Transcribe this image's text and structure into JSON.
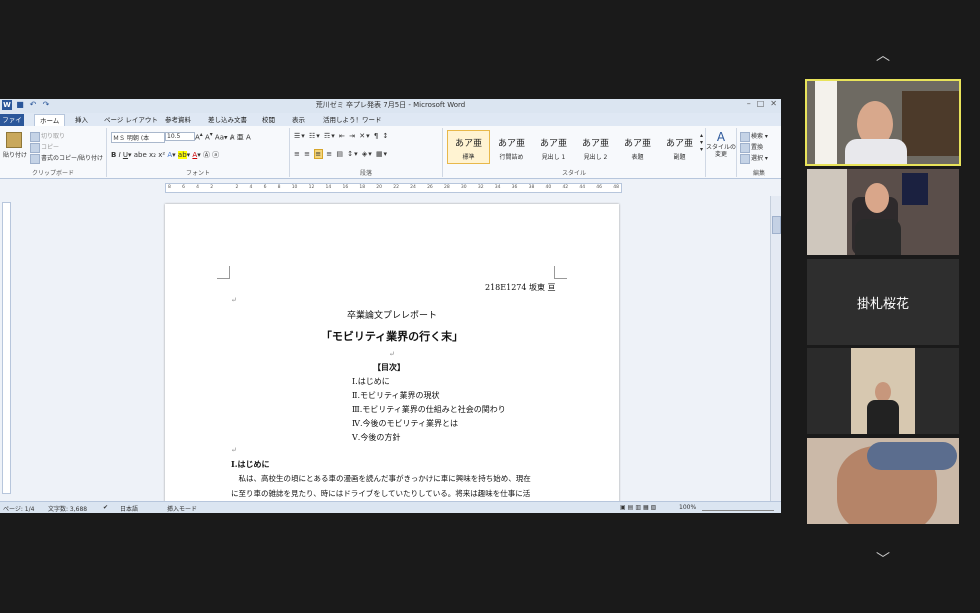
{
  "window": {
    "title": "荒川ゼミ 卒プレ発表 7月5日 - Microsoft Word",
    "qat_logo": "W"
  },
  "tabs": [
    "ファイル",
    "ホーム",
    "挿入",
    "ページ レイアウト",
    "参考資料",
    "差し込み文書",
    "校閲",
    "表示",
    "活用しよう！ワード"
  ],
  "ribbon": {
    "clipboard": {
      "paste": "貼り付け",
      "cut": "切り取り",
      "copy": "コピー",
      "format_painter": "書式のコピー/貼り付け",
      "label": "クリップボード"
    },
    "font": {
      "name": "ＭＳ 明朝 (本",
      "size": "10.5",
      "label": "フォント"
    },
    "paragraph": {
      "label": "段落"
    },
    "styles": {
      "items": [
        {
          "preview": "あア亜",
          "name": "標準"
        },
        {
          "preview": "あア亜",
          "name": "行間詰め"
        },
        {
          "preview": "あア亜",
          "name": "見出し 1"
        },
        {
          "preview": "あア亜",
          "name": "見出し 2"
        },
        {
          "preview": "あア亜",
          "name": "表題"
        },
        {
          "preview": "あア亜",
          "name": "副題"
        }
      ],
      "change": "スタイルの変更",
      "label": "スタイル"
    },
    "editing": {
      "find": "検索",
      "replace": "置換",
      "select": "選択",
      "label": "編集"
    }
  },
  "ruler_numbers": [
    "8",
    "6",
    "4",
    "2",
    "",
    "2",
    "4",
    "6",
    "8",
    "10",
    "12",
    "14",
    "16",
    "18",
    "20",
    "22",
    "24",
    "26",
    "28",
    "30",
    "32",
    "34",
    "36",
    "38",
    "40",
    "42",
    "44",
    "46",
    "48"
  ],
  "document": {
    "author_line": "218E1274 坂東 亘",
    "subtitle": "卒業論文プレレポート",
    "title": "「モビリティ業界の行く末」",
    "toc_heading": "【目次】",
    "toc": [
      "Ⅰ.はじめに",
      "Ⅱ.モビリティ業界の現状",
      "Ⅲ.モビリティ業界の仕組みと社会の関わり",
      "Ⅳ.今後のモビリティ業界とは",
      "Ⅴ.今後の方針"
    ],
    "section1_heading": "Ⅰ.はじめに",
    "body_line1": "　私は、高校生の頃にとある車の漫画を読んだ事がきっかけに車に興味を持ち始め、現在",
    "body_line2": "に至り車の雑誌を見たり、時にはドライブをしていたりしている。将来は趣味を仕事に活"
  },
  "status": {
    "page": "ページ: 1/4",
    "words": "文字数: 3,688",
    "lang": "日本語",
    "mode": "挿入モード",
    "zoom": "100%"
  },
  "participants": {
    "named_tile": "掛札桜花"
  },
  "colors": {
    "accent": "#2b579a",
    "active_speaker": "#e8e35a"
  }
}
